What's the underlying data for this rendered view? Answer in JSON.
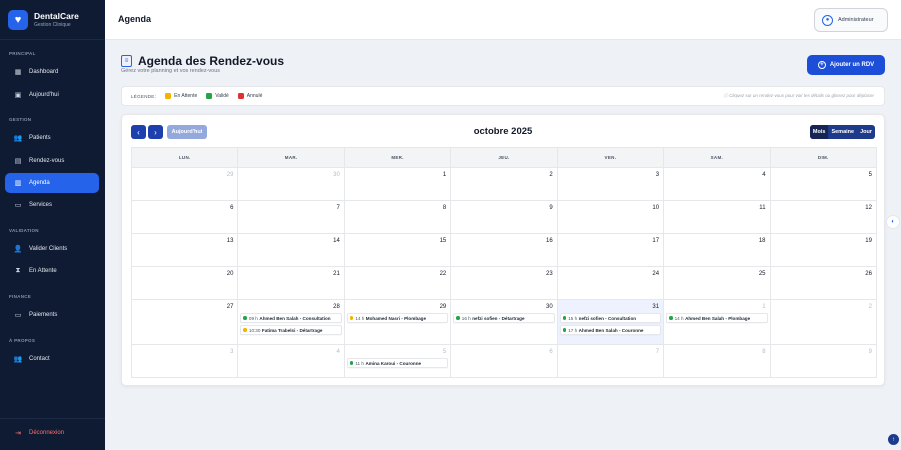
{
  "brand": {
    "name": "DentalCare",
    "subtitle": "Gestion Clinique"
  },
  "sidebar": {
    "sections": [
      {
        "label": "PRINCIPAL",
        "items": [
          {
            "label": "Dashboard",
            "icon": "grid-icon"
          },
          {
            "label": "Aujourd'hui",
            "icon": "calendar-day-icon"
          }
        ]
      },
      {
        "label": "GESTION",
        "items": [
          {
            "label": "Patients",
            "icon": "users-icon"
          },
          {
            "label": "Rendez-vous",
            "icon": "calendar-icon"
          },
          {
            "label": "Agenda",
            "icon": "agenda-icon",
            "active": true
          },
          {
            "label": "Services",
            "icon": "services-icon"
          }
        ]
      },
      {
        "label": "VALIDATION",
        "items": [
          {
            "label": "Valider Clients",
            "icon": "user-check-icon"
          },
          {
            "label": "En Attente",
            "icon": "hourglass-icon"
          }
        ]
      },
      {
        "label": "FINANCE",
        "items": [
          {
            "label": "Paiements",
            "icon": "money-icon"
          }
        ]
      },
      {
        "label": "À PROPOS",
        "items": [
          {
            "label": "Contact",
            "icon": "contact-icon"
          }
        ]
      }
    ],
    "logout": "Déconnexion"
  },
  "topbar": {
    "title": "Agenda",
    "user": "Administrateur"
  },
  "page": {
    "title": "Agenda des Rendez-vous",
    "subtitle": "Gérez votre planning et vos rendez-vous",
    "add_button": "Ajouter un RDV"
  },
  "legend": {
    "title": "LÉGENDE:",
    "items": [
      {
        "label": "En Attente",
        "color": "#f5b301"
      },
      {
        "label": "Validé",
        "color": "#22a447"
      },
      {
        "label": "Annulé",
        "color": "#e03131"
      }
    ],
    "hint": "Cliquez sur un rendez-vous pour voir les détails ou glissez pour déplacer"
  },
  "calendar": {
    "today_label": "Aujourd'hui",
    "month_title": "octobre 2025",
    "views": [
      {
        "label": "Mois",
        "active": true
      },
      {
        "label": "Semaine"
      },
      {
        "label": "Jour"
      }
    ],
    "weekdays": [
      "LUN.",
      "MAR.",
      "MER.",
      "JEU.",
      "VEN.",
      "SAM.",
      "DIM."
    ],
    "weeks": [
      [
        {
          "d": "29",
          "other": true
        },
        {
          "d": "30",
          "other": true
        },
        {
          "d": "1"
        },
        {
          "d": "2"
        },
        {
          "d": "3"
        },
        {
          "d": "4"
        },
        {
          "d": "5"
        }
      ],
      [
        {
          "d": "6"
        },
        {
          "d": "7"
        },
        {
          "d": "8"
        },
        {
          "d": "9"
        },
        {
          "d": "10"
        },
        {
          "d": "11"
        },
        {
          "d": "12"
        }
      ],
      [
        {
          "d": "13"
        },
        {
          "d": "14"
        },
        {
          "d": "15"
        },
        {
          "d": "16"
        },
        {
          "d": "17"
        },
        {
          "d": "18"
        },
        {
          "d": "19"
        }
      ],
      [
        {
          "d": "20"
        },
        {
          "d": "21"
        },
        {
          "d": "22"
        },
        {
          "d": "23"
        },
        {
          "d": "24"
        },
        {
          "d": "25"
        },
        {
          "d": "26"
        }
      ],
      [
        {
          "d": "27"
        },
        {
          "d": "28",
          "events": [
            {
              "time": "09 h",
              "title": "Ahmed Ben Salah - Consultation",
              "color": "#22a447"
            },
            {
              "time": "10:30",
              "title": "Fatima Trabelsi - Détartrage",
              "color": "#f5b301"
            }
          ]
        },
        {
          "d": "29",
          "events": [
            {
              "time": "14 h",
              "title": "Mohamed Nasri - Plombage",
              "color": "#f5b301"
            }
          ]
        },
        {
          "d": "30",
          "events": [
            {
              "time": "16 h",
              "title": "nefzi sofien - Détartrage",
              "color": "#22a447"
            }
          ]
        },
        {
          "d": "31",
          "today": true,
          "events": [
            {
              "time": "15 h",
              "title": "nefzi sofien - Consultation",
              "color": "#22a447"
            },
            {
              "time": "17 h",
              "title": "Ahmed Ben Salah - Couronne",
              "color": "#22a447"
            }
          ]
        },
        {
          "d": "1",
          "other": true,
          "events": [
            {
              "time": "14 h",
              "title": "Ahmed Ben Salah - Plombage",
              "color": "#22a447"
            }
          ]
        },
        {
          "d": "2",
          "other": true
        }
      ],
      [
        {
          "d": "3",
          "other": true
        },
        {
          "d": "4",
          "other": true
        },
        {
          "d": "5",
          "other": true,
          "events": [
            {
              "time": "11 h",
              "title": "Amina Karoui - Couronne",
              "color": "#22a447"
            }
          ]
        },
        {
          "d": "6",
          "other": true
        },
        {
          "d": "7",
          "other": true
        },
        {
          "d": "8",
          "other": true
        },
        {
          "d": "9",
          "other": true
        }
      ]
    ]
  }
}
